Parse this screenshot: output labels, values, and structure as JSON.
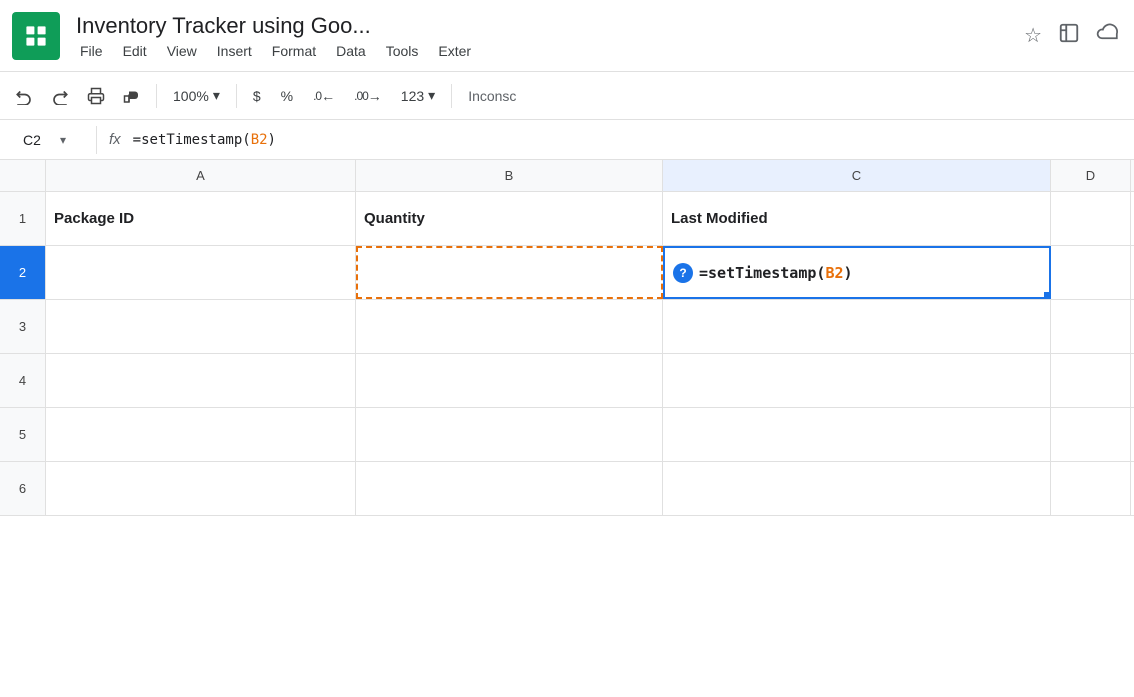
{
  "titleBar": {
    "docTitle": "Inventory Tracker using Goo...",
    "menuItems": [
      "File",
      "Edit",
      "View",
      "Insert",
      "Format",
      "Data",
      "Tools",
      "Exter"
    ],
    "icons": {
      "star": "☆",
      "folder": "⬚",
      "cloud": "☁"
    }
  },
  "toolbar": {
    "undo": "↩",
    "redo": "↪",
    "print": "🖨",
    "paintFormat": "🖌",
    "zoom": "100%",
    "zoomArrow": "▾",
    "currency": "$",
    "percent": "%",
    "decimalDecrease": ".0←",
    "decimalIncrease": ".00→",
    "moreFormats": "123",
    "moreFormatsArrow": "▾",
    "inconsistent": "Inconsc"
  },
  "formulaBar": {
    "cellRef": "C2",
    "fxLabel": "fx",
    "formula": "=setTimestamp(",
    "formulaRef": "B2",
    "formulaClose": ")"
  },
  "columns": {
    "rowNumHeader": "",
    "a": "A",
    "b": "B",
    "c": "C",
    "d": "D"
  },
  "rows": [
    {
      "rowNum": "1",
      "a": "Package ID",
      "b": "Quantity",
      "c": "Last Modified",
      "d": ""
    },
    {
      "rowNum": "2",
      "a": "",
      "b": "",
      "c": "",
      "d": ""
    },
    {
      "rowNum": "3",
      "a": "",
      "b": "",
      "c": "",
      "d": ""
    },
    {
      "rowNum": "4",
      "a": "",
      "b": "",
      "c": "",
      "d": ""
    },
    {
      "rowNum": "5",
      "a": "",
      "b": "",
      "c": "",
      "d": ""
    },
    {
      "rowNum": "6",
      "a": "",
      "b": "",
      "c": "",
      "d": ""
    }
  ],
  "formulaDisplay": {
    "prefix": "=setTimestamp(",
    "ref": "B2",
    "suffix": ")"
  }
}
